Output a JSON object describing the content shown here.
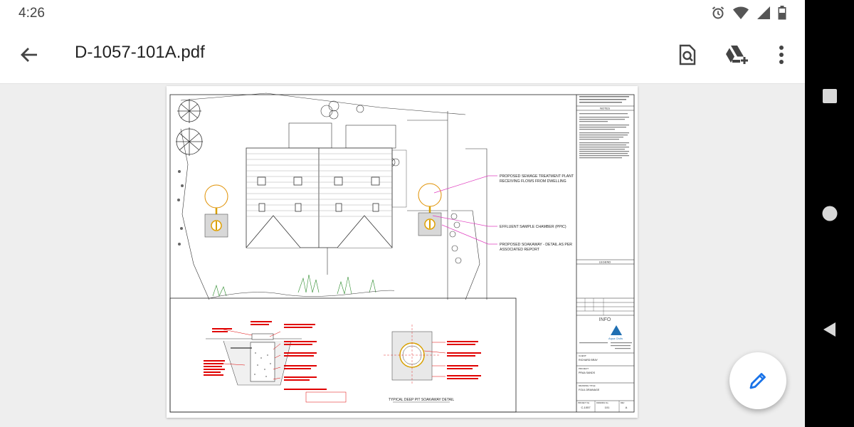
{
  "status_bar": {
    "time": "4:26",
    "icons": [
      "alarm-icon",
      "wifi-icon",
      "signal-icon",
      "battery-icon"
    ]
  },
  "app_bar": {
    "title": "D-1057-101A.pdf",
    "back_icon": "arrow-back-icon",
    "actions": [
      "find-in-page-icon",
      "add-to-drive-icon",
      "more-vert-icon"
    ]
  },
  "drawing": {
    "callouts": [
      "PROPOSED SEWAGE TREATMENT PLANT",
      "RECEIVING FLOWS FROM DWELLING",
      "EFFLUENT SAMPLE CHAMBER (PPIC)",
      "PROPOSED SOAKAWAY - DETAIL AS PER",
      "ASSOCIATED REPORT"
    ],
    "detail_title": "TYPICAL DEEP PIT SOAKAWAY DETAIL",
    "title_block": {
      "notes_heading": "NOTES",
      "legend_heading": "LEGEND",
      "info_heading": "INFO",
      "company": "Aqua Civils",
      "client_label": "CLIENT:",
      "client": "RICHARD BRAY",
      "project_label": "PROJECT:",
      "project": "PRAA SANDS",
      "drawing_label": "DRAWING TITLE:",
      "drawing": "FOUL DRAINAGE",
      "project_no_label": "PROJECT No.",
      "project_no": "C-1057",
      "drawing_no_label": "DRAWING No.",
      "drawing_no": "101",
      "rev_label": "REV",
      "rev": "A"
    }
  },
  "nav_bar": {
    "buttons": [
      "recents-button",
      "home-button",
      "back-button"
    ]
  },
  "fab": {
    "icon": "edit-pencil-icon"
  },
  "colors": {
    "background": "#eeeeee",
    "page": "#ffffff",
    "fab_icon": "#1a73e8",
    "callout_line": "#e040c0",
    "annotation_red": "#e00000",
    "logo_blue": "#1f6fb2"
  }
}
